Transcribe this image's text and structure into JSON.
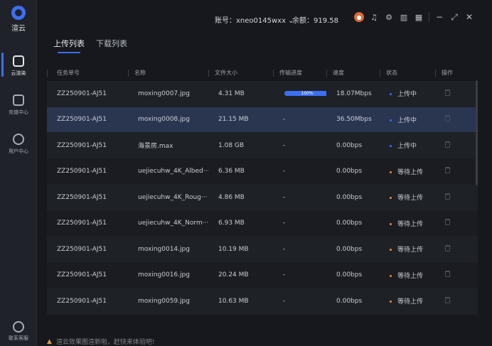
{
  "sidebar": {
    "logo_text": "渲云",
    "items": [
      {
        "label": "云渲染"
      },
      {
        "label": "充值中心"
      },
      {
        "label": "用户中心"
      }
    ],
    "bottom_label": "联系客服"
  },
  "header": {
    "account": "账号：xneo0145wxx ⌄",
    "balance": "余额：919.58"
  },
  "tabs": [
    {
      "label": "上传列表"
    },
    {
      "label": "下载列表"
    }
  ],
  "table": {
    "headers": [
      "任务单号",
      "名称",
      "文件大小",
      "传输进度",
      "速度",
      "状态",
      "操作"
    ],
    "rows": [
      {
        "id": "ZZ250901-AJ51",
        "name": "moxing0007.jpg",
        "size": "4.31 MB",
        "progress": "100%",
        "speed": "18.07Mbps",
        "status": "上传中",
        "status_type": "up"
      },
      {
        "id": "ZZ250901-AJ51",
        "name": "moxing0008.jpg",
        "size": "21.15 MB",
        "progress": "-",
        "speed": "36.50Mbps",
        "status": "上传中",
        "status_type": "up"
      },
      {
        "id": "ZZ250901-AJ51",
        "name": "海景房.max",
        "size": "1.08 GB",
        "progress": "-",
        "speed": "0.00bps",
        "status": "上传中",
        "status_type": "up"
      },
      {
        "id": "ZZ250901-AJ51",
        "name": "uejiecuhw_4K_Albed···",
        "size": "6.36 MB",
        "progress": "-",
        "speed": "0.00bps",
        "status": "等待上传",
        "status_type": "wait"
      },
      {
        "id": "ZZ250901-AJ51",
        "name": "uejiecuhw_4K_Roug···",
        "size": "4.86 MB",
        "progress": "-",
        "speed": "0.00bps",
        "status": "等待上传",
        "status_type": "wait"
      },
      {
        "id": "ZZ250901-AJ51",
        "name": "uejiecuhw_4K_Norm···",
        "size": "6.93 MB",
        "progress": "-",
        "speed": "0.00bps",
        "status": "等待上传",
        "status_type": "wait"
      },
      {
        "id": "ZZ250901-AJ51",
        "name": "moxing0014.jpg",
        "size": "10.19 MB",
        "progress": "-",
        "speed": "0.00bps",
        "status": "等待上传",
        "status_type": "wait"
      },
      {
        "id": "ZZ250901-AJ51",
        "name": "moxing0016.jpg",
        "size": "20.24 MB",
        "progress": "-",
        "speed": "0.00bps",
        "status": "等待上传",
        "status_type": "wait"
      },
      {
        "id": "ZZ250901-AJ51",
        "name": "moxing0059.jpg",
        "size": "10.63 MB",
        "progress": "-",
        "speed": "0.00bps",
        "status": "等待上传",
        "status_type": "wait"
      }
    ]
  },
  "footer": {
    "notice": "渲云效果图渲新啦，赶快来体验吧!"
  },
  "colors": {
    "accent": "#3d6ff5",
    "waiting": "#f08a3a",
    "selected_row": "#2a3550"
  }
}
